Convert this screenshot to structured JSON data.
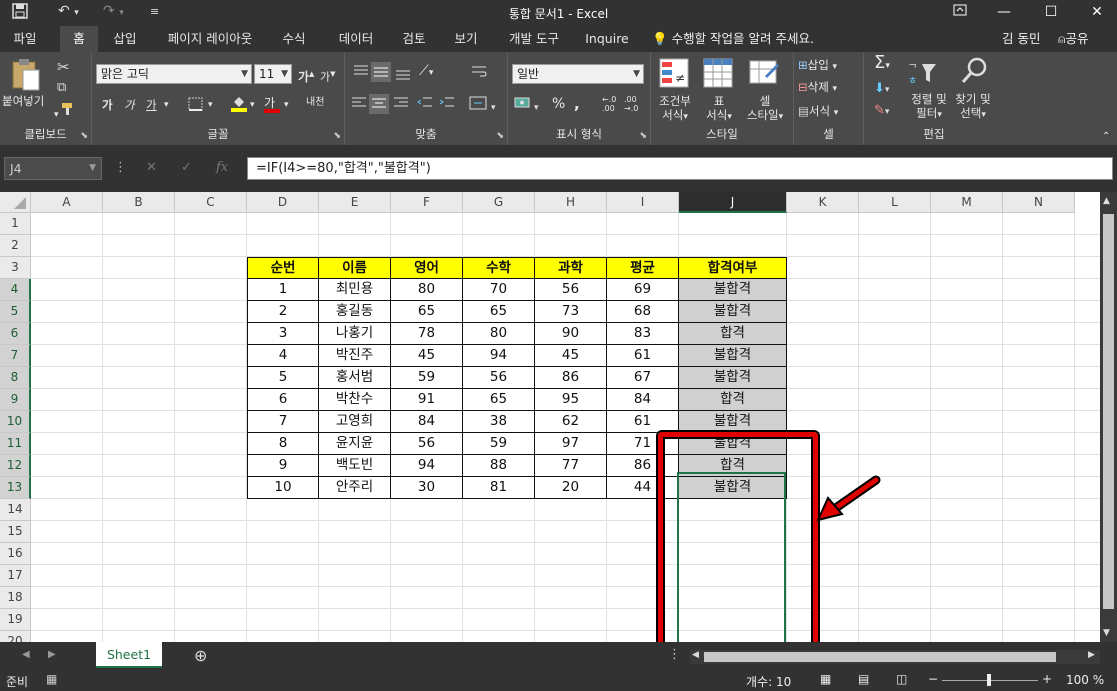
{
  "window": {
    "title": "통합 문서1 - Excel"
  },
  "menu": {
    "tabs": [
      "파일",
      "홈",
      "삽입",
      "페이지 레이아웃",
      "수식",
      "데이터",
      "검토",
      "보기",
      "개발 도구",
      "Inquire"
    ],
    "active_tab": "홈",
    "tell_me": "수행할 작업을 알려 주세요.",
    "user": "김 동민",
    "share": "공유"
  },
  "ribbon": {
    "clipboard": {
      "paste": "붙여넣기",
      "label": "클립보드"
    },
    "font": {
      "name": "맑은 고딕",
      "size": "11",
      "label": "글꼴",
      "bold": "가",
      "italic": "가",
      "underline": "가",
      "fontcolor": "가",
      "phonetic": "내천"
    },
    "alignment": {
      "label": "맞춤"
    },
    "number": {
      "format": "일반",
      "label": "표시 형식",
      "percent": "%"
    },
    "styles": {
      "conditional_1": "조건부",
      "conditional_2": "서식",
      "table_1": "표",
      "table_2": "서식",
      "cell_1": "셀",
      "cell_2": "스타일",
      "label": "스타일"
    },
    "cells": {
      "insert": "삽입",
      "delete": "삭제",
      "format": "서식",
      "label": "셀"
    },
    "editing": {
      "sort_1": "정렬 및",
      "sort_2": "필터",
      "find_1": "찾기 및",
      "find_2": "선택",
      "label": "편집"
    }
  },
  "formula_bar": {
    "name_box": "J4",
    "formula": "=IF(I4>=80,\"합격\",\"불합격\")"
  },
  "grid": {
    "columns": [
      "A",
      "B",
      "C",
      "D",
      "E",
      "F",
      "G",
      "H",
      "I",
      "J",
      "K",
      "L",
      "M",
      "N"
    ],
    "rows": [
      "1",
      "2",
      "3",
      "4",
      "5",
      "6",
      "7",
      "8",
      "9",
      "10",
      "11",
      "12",
      "13",
      "14",
      "15",
      "16",
      "17",
      "18",
      "19",
      "20"
    ],
    "selected_column": "J",
    "table_headers": [
      "순번",
      "이름",
      "영어",
      "수학",
      "과학",
      "평균",
      "합격여부"
    ],
    "table_rows": [
      [
        "1",
        "최민용",
        "80",
        "70",
        "56",
        "69",
        "불합격"
      ],
      [
        "2",
        "홍길동",
        "65",
        "65",
        "73",
        "68",
        "불합격"
      ],
      [
        "3",
        "나홍기",
        "78",
        "80",
        "90",
        "83",
        "합격"
      ],
      [
        "4",
        "박진주",
        "45",
        "94",
        "45",
        "61",
        "불합격"
      ],
      [
        "5",
        "홍서범",
        "59",
        "56",
        "86",
        "67",
        "불합격"
      ],
      [
        "6",
        "박찬수",
        "91",
        "65",
        "95",
        "84",
        "합격"
      ],
      [
        "7",
        "고영희",
        "84",
        "38",
        "62",
        "61",
        "불합격"
      ],
      [
        "8",
        "윤지윤",
        "56",
        "59",
        "97",
        "71",
        "불합격"
      ],
      [
        "9",
        "백도빈",
        "94",
        "88",
        "77",
        "86",
        "합격"
      ],
      [
        "10",
        "안주리",
        "30",
        "81",
        "20",
        "44",
        "불합격"
      ]
    ]
  },
  "sheets": {
    "active": "Sheet1"
  },
  "status": {
    "ready": "준비",
    "count": "개수: 10",
    "zoom": "100 %"
  },
  "colors": {
    "header_fill": "#ffff00",
    "result_fill": "#d0d0d0",
    "highlight_box": "#e00000",
    "excel_green": "#217346"
  }
}
